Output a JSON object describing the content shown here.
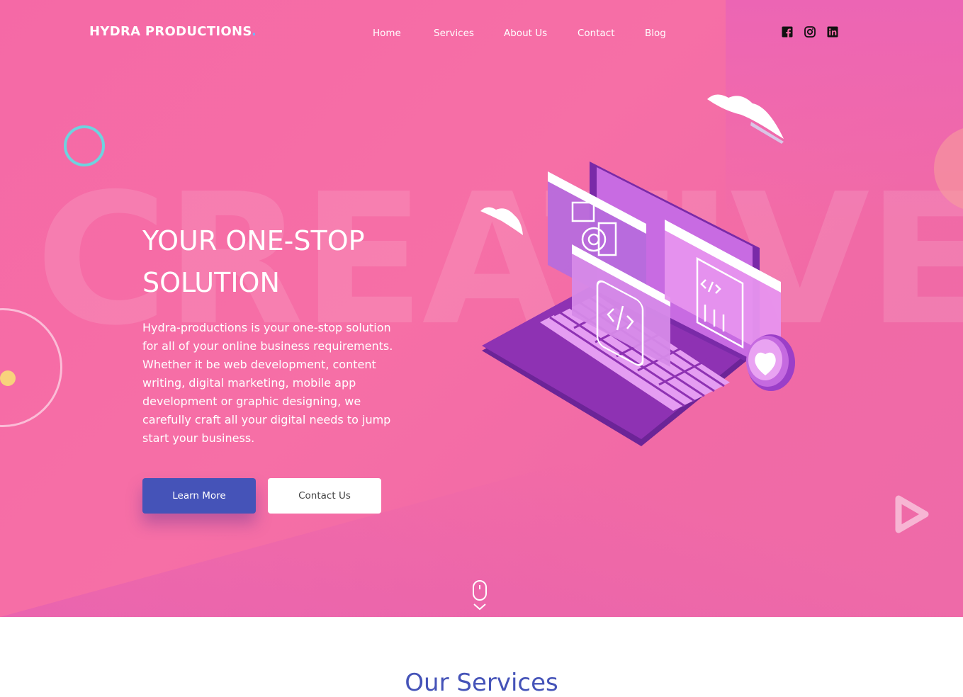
{
  "header": {
    "brand": "HYDRA PRODUCTIONS",
    "brand_dot": ".",
    "nav": [
      "Home",
      "Services",
      "About Us",
      "Contact",
      "Blog"
    ],
    "social_icons": [
      "facebook-icon",
      "instagram-icon",
      "linkedin-icon"
    ]
  },
  "hero": {
    "background_word": "CREATIVE",
    "headline_line1": "YOUR ONE-STOP",
    "headline_line2": "SOLUTION",
    "description": "Hydra-productions is your one-stop solution for all of your online business requirements. Whether it be web development, content writing, digital marketing, mobile app development or graphic designing, we carefully craft all your digital needs to jump start your business.",
    "primary_button": "Learn More",
    "secondary_button": "Contact Us"
  },
  "services": {
    "heading": "Our Services"
  },
  "colors": {
    "hero_pink": "#f569a6",
    "button_blue": "#4553b8",
    "accent_cyan": "#6ed3df",
    "accent_yellow": "#f8d27c",
    "laptop_purple": "#8a2fb0"
  }
}
